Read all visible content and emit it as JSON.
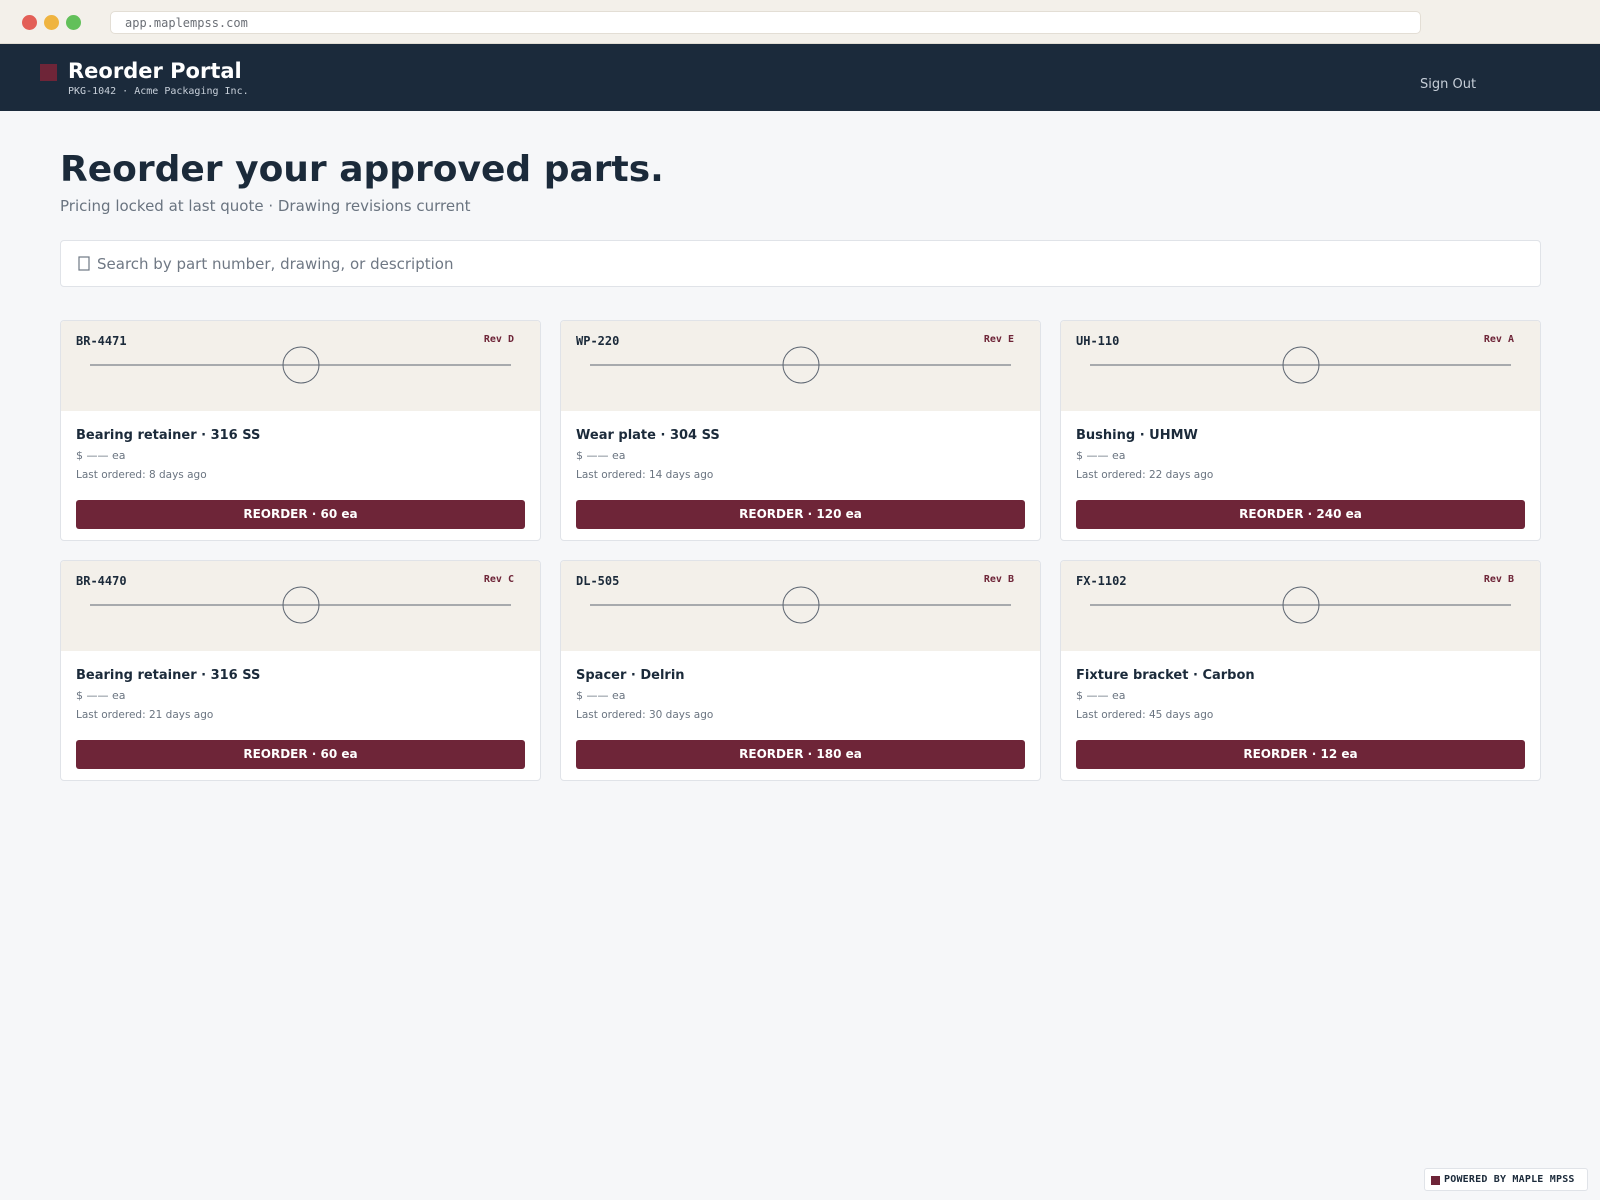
{
  "browser": {
    "url": "app.maplempss.com"
  },
  "header": {
    "title": "Reorder Portal",
    "subtitle": "PKG-1042 · Acme Packaging Inc.",
    "sign_out_label": "Sign Out"
  },
  "hero": {
    "title": "Reorder your approved parts.",
    "subtitle": "Pricing locked at last quote · Drawing revisions current"
  },
  "search": {
    "placeholder": "Search by part number, drawing, or description",
    "icon": "search-icon"
  },
  "parts": [
    {
      "part_no": "BR-4471",
      "rev": "Rev D",
      "name": "Bearing retainer · 316 SS",
      "price": "$ —— ea",
      "last_ordered": "Last ordered: 8 days ago",
      "button": "REORDER · 60 ea"
    },
    {
      "part_no": "WP-220",
      "rev": "Rev E",
      "name": "Wear plate · 304 SS",
      "price": "$ —— ea",
      "last_ordered": "Last ordered: 14 days ago",
      "button": "REORDER · 120 ea"
    },
    {
      "part_no": "UH-110",
      "rev": "Rev A",
      "name": "Bushing · UHMW",
      "price": "$ —— ea",
      "last_ordered": "Last ordered: 22 days ago",
      "button": "REORDER · 240 ea"
    },
    {
      "part_no": "BR-4470",
      "rev": "Rev C",
      "name": "Bearing retainer · 316 SS",
      "price": "$ —— ea",
      "last_ordered": "Last ordered: 21 days ago",
      "button": "REORDER · 60 ea"
    },
    {
      "part_no": "DL-505",
      "rev": "Rev B",
      "name": "Spacer · Delrin",
      "price": "$ —— ea",
      "last_ordered": "Last ordered: 30 days ago",
      "button": "REORDER · 180 ea"
    },
    {
      "part_no": "FX-1102",
      "rev": "Rev B",
      "name": "Fixture bracket · Carbon",
      "price": "$ —— ea",
      "last_ordered": "Last ordered: 45 days ago",
      "button": "REORDER · 12 ea"
    }
  ],
  "footer": {
    "powered_by": "POWERED BY MAPLE MPSS"
  },
  "colors": {
    "header_bg": "#1b2a3b",
    "accent": "#6e2538",
    "page_bg": "#f6f7f9",
    "drawing_bg": "#f3f0ea"
  }
}
